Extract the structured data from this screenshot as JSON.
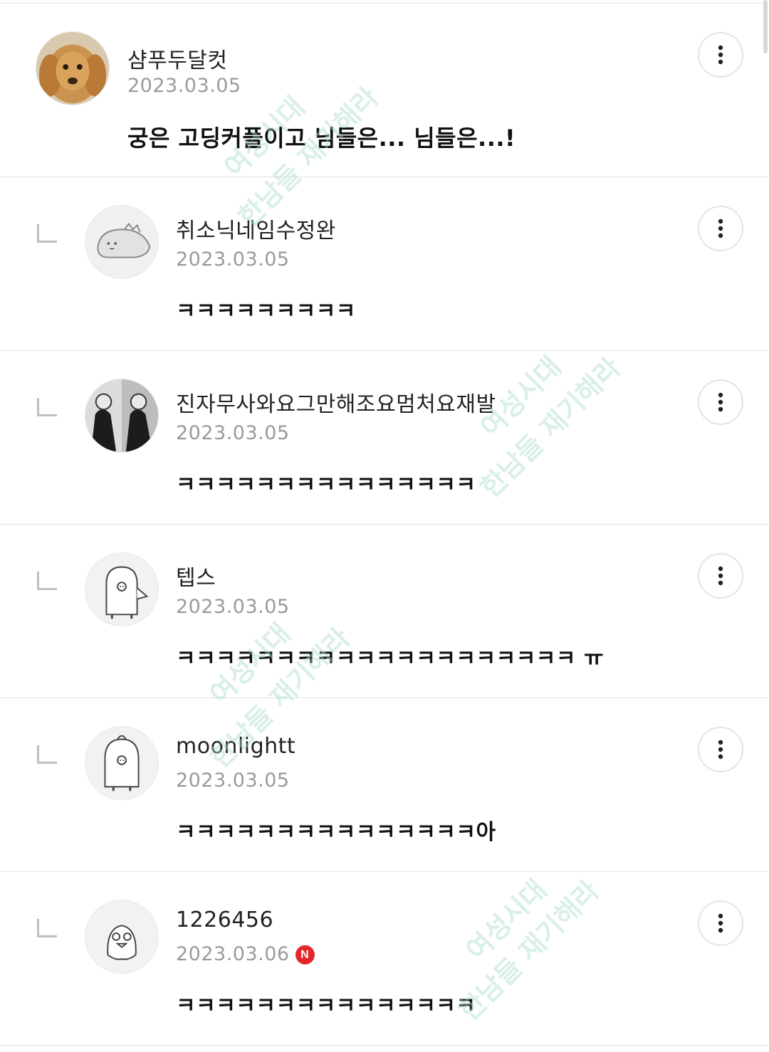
{
  "watermark": {
    "line1": "여성시대",
    "line2": "한남들 재기해라"
  },
  "comments": [
    {
      "name": "샴푸두달컷",
      "date": "2023.03.05",
      "body": "궁은 고딩커플이고 님들은... 님들은...!",
      "is_reply": false,
      "avatar": "dog-photo"
    },
    {
      "name": "취소닉네임수정완",
      "date": "2023.03.05",
      "body": "ㅋㅋㅋㅋㅋㅋㅋㅋㅋ",
      "is_reply": true,
      "avatar": "dino-drawing"
    },
    {
      "name": "진자무사와요그만해조요멈처요재발",
      "date": "2023.03.05",
      "body": "ㅋㅋㅋㅋㅋㅋㅋㅋㅋㅋㅋㅋㅋㅋㅋ",
      "is_reply": true,
      "avatar": "bw-photo"
    },
    {
      "name": "텝스",
      "date": "2023.03.05",
      "body": "ㅋㅋㅋㅋㅋㅋㅋㅋㅋㅋㅋㅋㅋㅋㅋㅋㅋㅋㅋㅋ ㅠ",
      "is_reply": true,
      "avatar": "penguin-drawing"
    },
    {
      "name": "moonlightt",
      "date": "2023.03.05",
      "body": "ㅋㅋㅋㅋㅋㅋㅋㅋㅋㅋㅋㅋㅋㅋㅋ아",
      "is_reply": true,
      "avatar": "penguin-drawing"
    },
    {
      "name": "1226456",
      "date": "2023.03.06",
      "badge": "N",
      "body": "ㅋㅋㅋㅋㅋㅋㅋㅋㅋㅋㅋㅋㅋㅋㅋ",
      "is_reply": true,
      "avatar": "chick-drawing"
    }
  ]
}
